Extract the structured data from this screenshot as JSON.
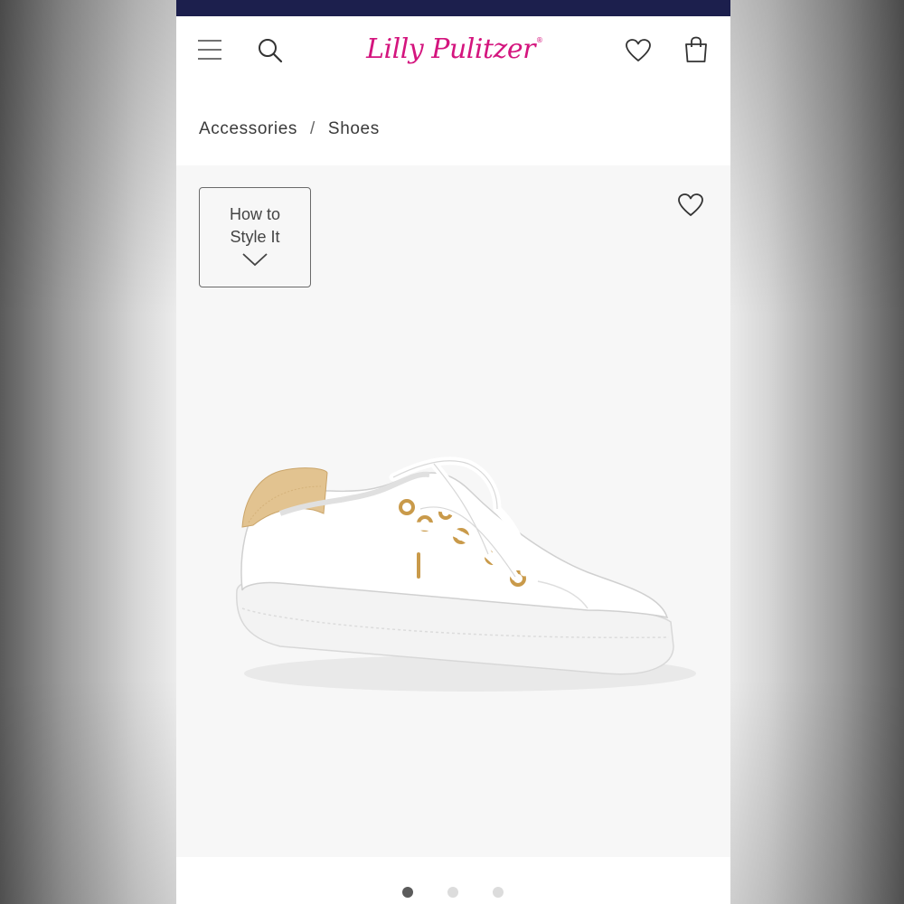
{
  "brand": {
    "logo_text": "Lilly Pulitzer",
    "logo_mark": "®",
    "logo_color": "#d4157e"
  },
  "colors": {
    "top_strip": "#1c1f4d",
    "product_bg": "#f7f7f7",
    "active_dot": "#5b5b5b",
    "inactive_dot": "#dcdcdc"
  },
  "header": {
    "icons": [
      "menu-icon",
      "search-icon",
      "heart-icon",
      "shopping-bag-icon"
    ]
  },
  "breadcrumb": {
    "items": [
      "Accessories",
      "Shoes"
    ],
    "separator": "/"
  },
  "product": {
    "style_button": {
      "line1": "How to",
      "line2": "Style It"
    },
    "image": "white-lace-up-sneaker"
  },
  "carousel": {
    "total_slides": 3,
    "active_slide": 1
  }
}
